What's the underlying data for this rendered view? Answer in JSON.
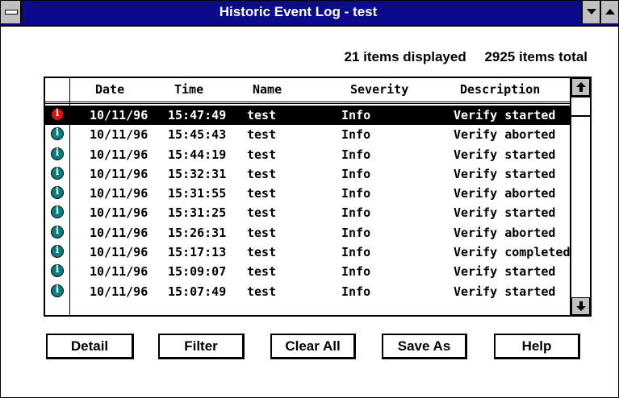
{
  "window": {
    "title": "Historic Event Log - test"
  },
  "summary": {
    "displayed": "21 items displayed",
    "total": "2925 items total"
  },
  "columns": [
    "Date",
    "Time",
    "Name",
    "Severity",
    "Description"
  ],
  "rows": [
    {
      "date": "10/11/96",
      "time": "15:47:49",
      "name": "test",
      "severity": "Info",
      "description": "Verify started",
      "selected": true,
      "icon": "info-icon-red"
    },
    {
      "date": "10/11/96",
      "time": "15:45:43",
      "name": "test",
      "severity": "Info",
      "description": "Verify aborted",
      "icon": "info-icon-teal"
    },
    {
      "date": "10/11/96",
      "time": "15:44:19",
      "name": "test",
      "severity": "Info",
      "description": "Verify started",
      "icon": "info-icon-teal"
    },
    {
      "date": "10/11/96",
      "time": "15:32:31",
      "name": "test",
      "severity": "Info",
      "description": "Verify started",
      "icon": "info-icon-teal"
    },
    {
      "date": "10/11/96",
      "time": "15:31:55",
      "name": "test",
      "severity": "Info",
      "description": "Verify aborted",
      "icon": "info-icon-teal"
    },
    {
      "date": "10/11/96",
      "time": "15:31:25",
      "name": "test",
      "severity": "Info",
      "description": "Verify started",
      "icon": "info-icon-teal"
    },
    {
      "date": "10/11/96",
      "time": "15:26:31",
      "name": "test",
      "severity": "Info",
      "description": "Verify aborted",
      "icon": "info-icon-teal"
    },
    {
      "date": "10/11/96",
      "time": "15:17:13",
      "name": "test",
      "severity": "Info",
      "description": "Verify completed",
      "icon": "info-icon-teal"
    },
    {
      "date": "10/11/96",
      "time": "15:09:07",
      "name": "test",
      "severity": "Info",
      "description": "Verify started",
      "icon": "info-icon-teal"
    },
    {
      "date": "10/11/96",
      "time": "15:07:49",
      "name": "test",
      "severity": "Info",
      "description": "Verify started",
      "icon": "info-icon-teal"
    }
  ],
  "buttons": {
    "detail": "Detail",
    "filter": "Filter",
    "clear_all": "Clear All",
    "save_as": "Save As",
    "help": "Help"
  },
  "colors": {
    "titlebar": "#0a0a8a",
    "selected_row_bg": "#000000",
    "info_icon_selected": "#e01010",
    "info_icon": "#008080"
  },
  "scrollbar": {
    "up_icon": "arrow-up-icon",
    "down_icon": "arrow-down-icon"
  }
}
